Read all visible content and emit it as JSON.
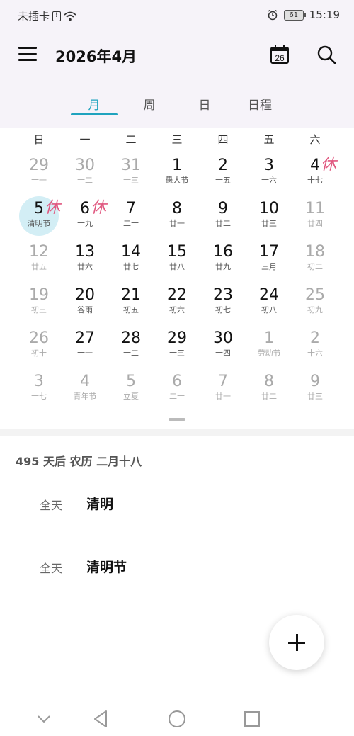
{
  "status": {
    "carrier": "未插卡",
    "sim_badge": "!",
    "battery": "61",
    "time": "15:19"
  },
  "header": {
    "title": "2026年4月",
    "today_icon_day": "26"
  },
  "tabs": [
    "月",
    "周",
    "日",
    "日程"
  ],
  "weekdays": [
    "日",
    "一",
    "二",
    "三",
    "四",
    "五",
    "六"
  ],
  "calendar": {
    "rows": [
      [
        {
          "d": "29",
          "s": "十一",
          "dim": true
        },
        {
          "d": "30",
          "s": "十二",
          "dim": true
        },
        {
          "d": "31",
          "s": "十三",
          "dim": true
        },
        {
          "d": "1",
          "s": "愚人节"
        },
        {
          "d": "2",
          "s": "十五"
        },
        {
          "d": "3",
          "s": "十六"
        },
        {
          "d": "4",
          "s": "十七",
          "rest": "休"
        }
      ],
      [
        {
          "d": "5",
          "s": "清明节",
          "today": true,
          "rest": "休"
        },
        {
          "d": "6",
          "s": "十九",
          "rest": "休"
        },
        {
          "d": "7",
          "s": "二十"
        },
        {
          "d": "8",
          "s": "廿一"
        },
        {
          "d": "9",
          "s": "廿二"
        },
        {
          "d": "10",
          "s": "廿三"
        },
        {
          "d": "11",
          "s": "廿四",
          "dim": true
        }
      ],
      [
        {
          "d": "12",
          "s": "廿五",
          "dim": true
        },
        {
          "d": "13",
          "s": "廿六"
        },
        {
          "d": "14",
          "s": "廿七"
        },
        {
          "d": "15",
          "s": "廿八"
        },
        {
          "d": "16",
          "s": "廿九"
        },
        {
          "d": "17",
          "s": "三月"
        },
        {
          "d": "18",
          "s": "初二",
          "dim": true
        }
      ],
      [
        {
          "d": "19",
          "s": "初三",
          "dim": true
        },
        {
          "d": "20",
          "s": "谷雨"
        },
        {
          "d": "21",
          "s": "初五"
        },
        {
          "d": "22",
          "s": "初六"
        },
        {
          "d": "23",
          "s": "初七"
        },
        {
          "d": "24",
          "s": "初八"
        },
        {
          "d": "25",
          "s": "初九",
          "dim": true
        }
      ],
      [
        {
          "d": "26",
          "s": "初十",
          "dim": true
        },
        {
          "d": "27",
          "s": "十一"
        },
        {
          "d": "28",
          "s": "十二"
        },
        {
          "d": "29",
          "s": "十三"
        },
        {
          "d": "30",
          "s": "十四"
        },
        {
          "d": "1",
          "s": "劳动节",
          "dim": true
        },
        {
          "d": "2",
          "s": "十六",
          "dim": true
        }
      ],
      [
        {
          "d": "3",
          "s": "十七",
          "dim": true
        },
        {
          "d": "4",
          "s": "青年节",
          "dim": true
        },
        {
          "d": "5",
          "s": "立夏",
          "dim": true
        },
        {
          "d": "6",
          "s": "二十",
          "dim": true
        },
        {
          "d": "7",
          "s": "廿一",
          "dim": true
        },
        {
          "d": "8",
          "s": "廿二",
          "dim": true
        },
        {
          "d": "9",
          "s": "廿三",
          "dim": true
        }
      ]
    ]
  },
  "selected_info": "495 天后  农历 二月十八",
  "events": [
    {
      "time": "全天",
      "name": "清明"
    },
    {
      "time": "全天",
      "name": "清明节"
    }
  ],
  "colors": {
    "accent": "#1fa3be",
    "rest_mark": "#e0577f",
    "today_bg": "#d3eef5"
  },
  "icons": [
    "menu-icon",
    "calendar-today-icon",
    "search-icon",
    "add-icon",
    "back-icon",
    "home-icon",
    "recents-icon"
  ]
}
